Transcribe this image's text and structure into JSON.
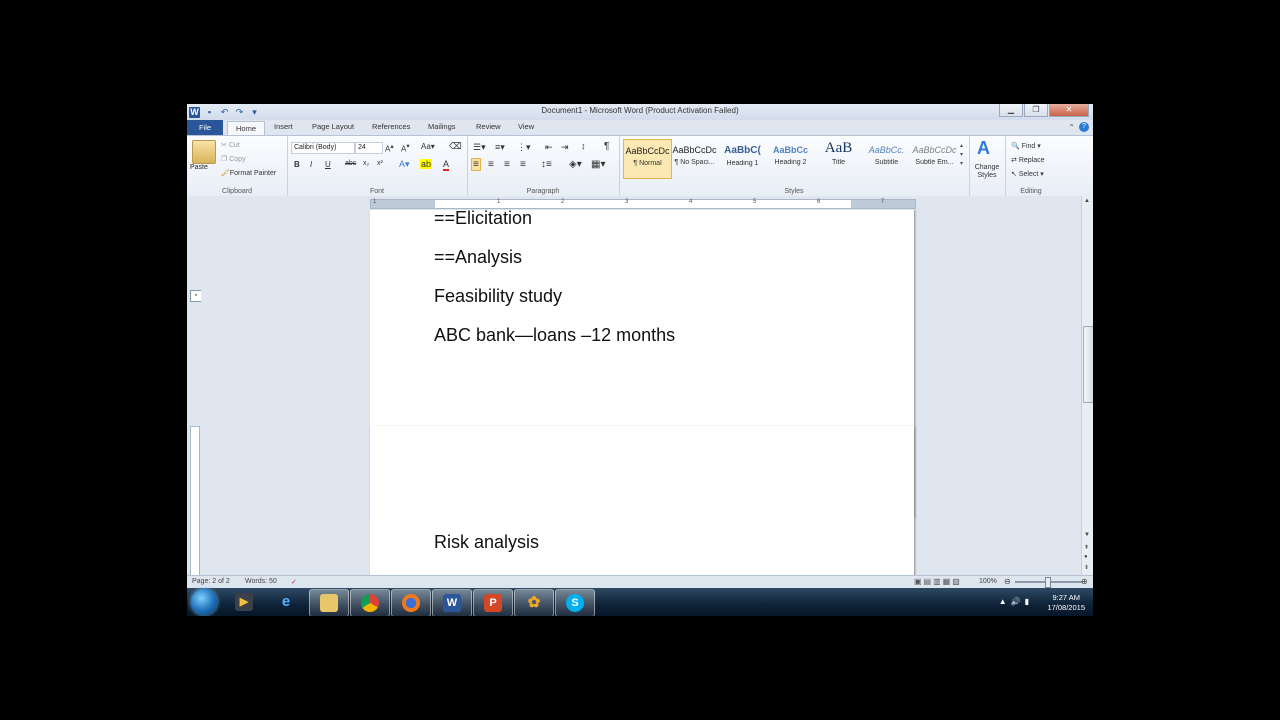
{
  "window": {
    "title": "Document1 - Microsoft Word (Product Activation Failed)",
    "minimize": "▁",
    "restore": "❐",
    "close": "✕"
  },
  "tabs": [
    "File",
    "Home",
    "Insert",
    "Page Layout",
    "References",
    "Mailings",
    "Review",
    "View"
  ],
  "clipboard": {
    "paste": "Paste",
    "cut": "Cut",
    "copy": "Copy",
    "format_painter": "Format Painter",
    "label": "Clipboard"
  },
  "font": {
    "name": "Calibri (Body)",
    "size": "24",
    "label": "Font",
    "bold": "B",
    "italic": "I",
    "underline": "U",
    "strike": "abc",
    "sub": "x₂",
    "sup": "x²"
  },
  "paragraph": {
    "label": "Paragraph",
    "pilcrow": "¶"
  },
  "styles": {
    "label": "Styles",
    "items": [
      {
        "sample": "AaBbCcDc",
        "name": "¶ Normal"
      },
      {
        "sample": "AaBbCcDc",
        "name": "¶ No Spaci..."
      },
      {
        "sample": "AaBbC(",
        "name": "Heading 1"
      },
      {
        "sample": "AaBbCc",
        "name": "Heading 2"
      },
      {
        "sample": "AaB",
        "name": "Title"
      },
      {
        "sample": "AaBbCc.",
        "name": "Subtitle"
      },
      {
        "sample": "AaBbCcDc",
        "name": "Subtle Em..."
      }
    ],
    "change_styles": "Change Styles"
  },
  "editing": {
    "label": "Editing",
    "find": "Find",
    "replace": "Replace",
    "select": "Select"
  },
  "ruler": {
    "numbers": [
      "1",
      "1",
      "2",
      "3",
      "4",
      "5",
      "6",
      "7"
    ]
  },
  "document": {
    "page1_lines": [
      "==Elicitation",
      "==Analysis",
      "Feasibility study",
      "ABC bank—loans –12 months"
    ],
    "page2_lines": [
      "Risk analysis"
    ]
  },
  "status": {
    "page": "Page: 2 of 2",
    "words": "Words: 50",
    "zoom": "100%"
  },
  "taskbar": {
    "apps": [
      "Windows Explorer",
      "Media",
      "Internet Explorer",
      "Libraries",
      "Chrome",
      "Firefox",
      "Word",
      "PowerPoint",
      "Paint",
      "Skype"
    ],
    "time": "9:27 AM",
    "date": "17/08/2015"
  },
  "colors": {
    "word_blue": "#2b579a",
    "ribbon_bg": "#f6f8fb",
    "taskbar": "#0e2237"
  }
}
